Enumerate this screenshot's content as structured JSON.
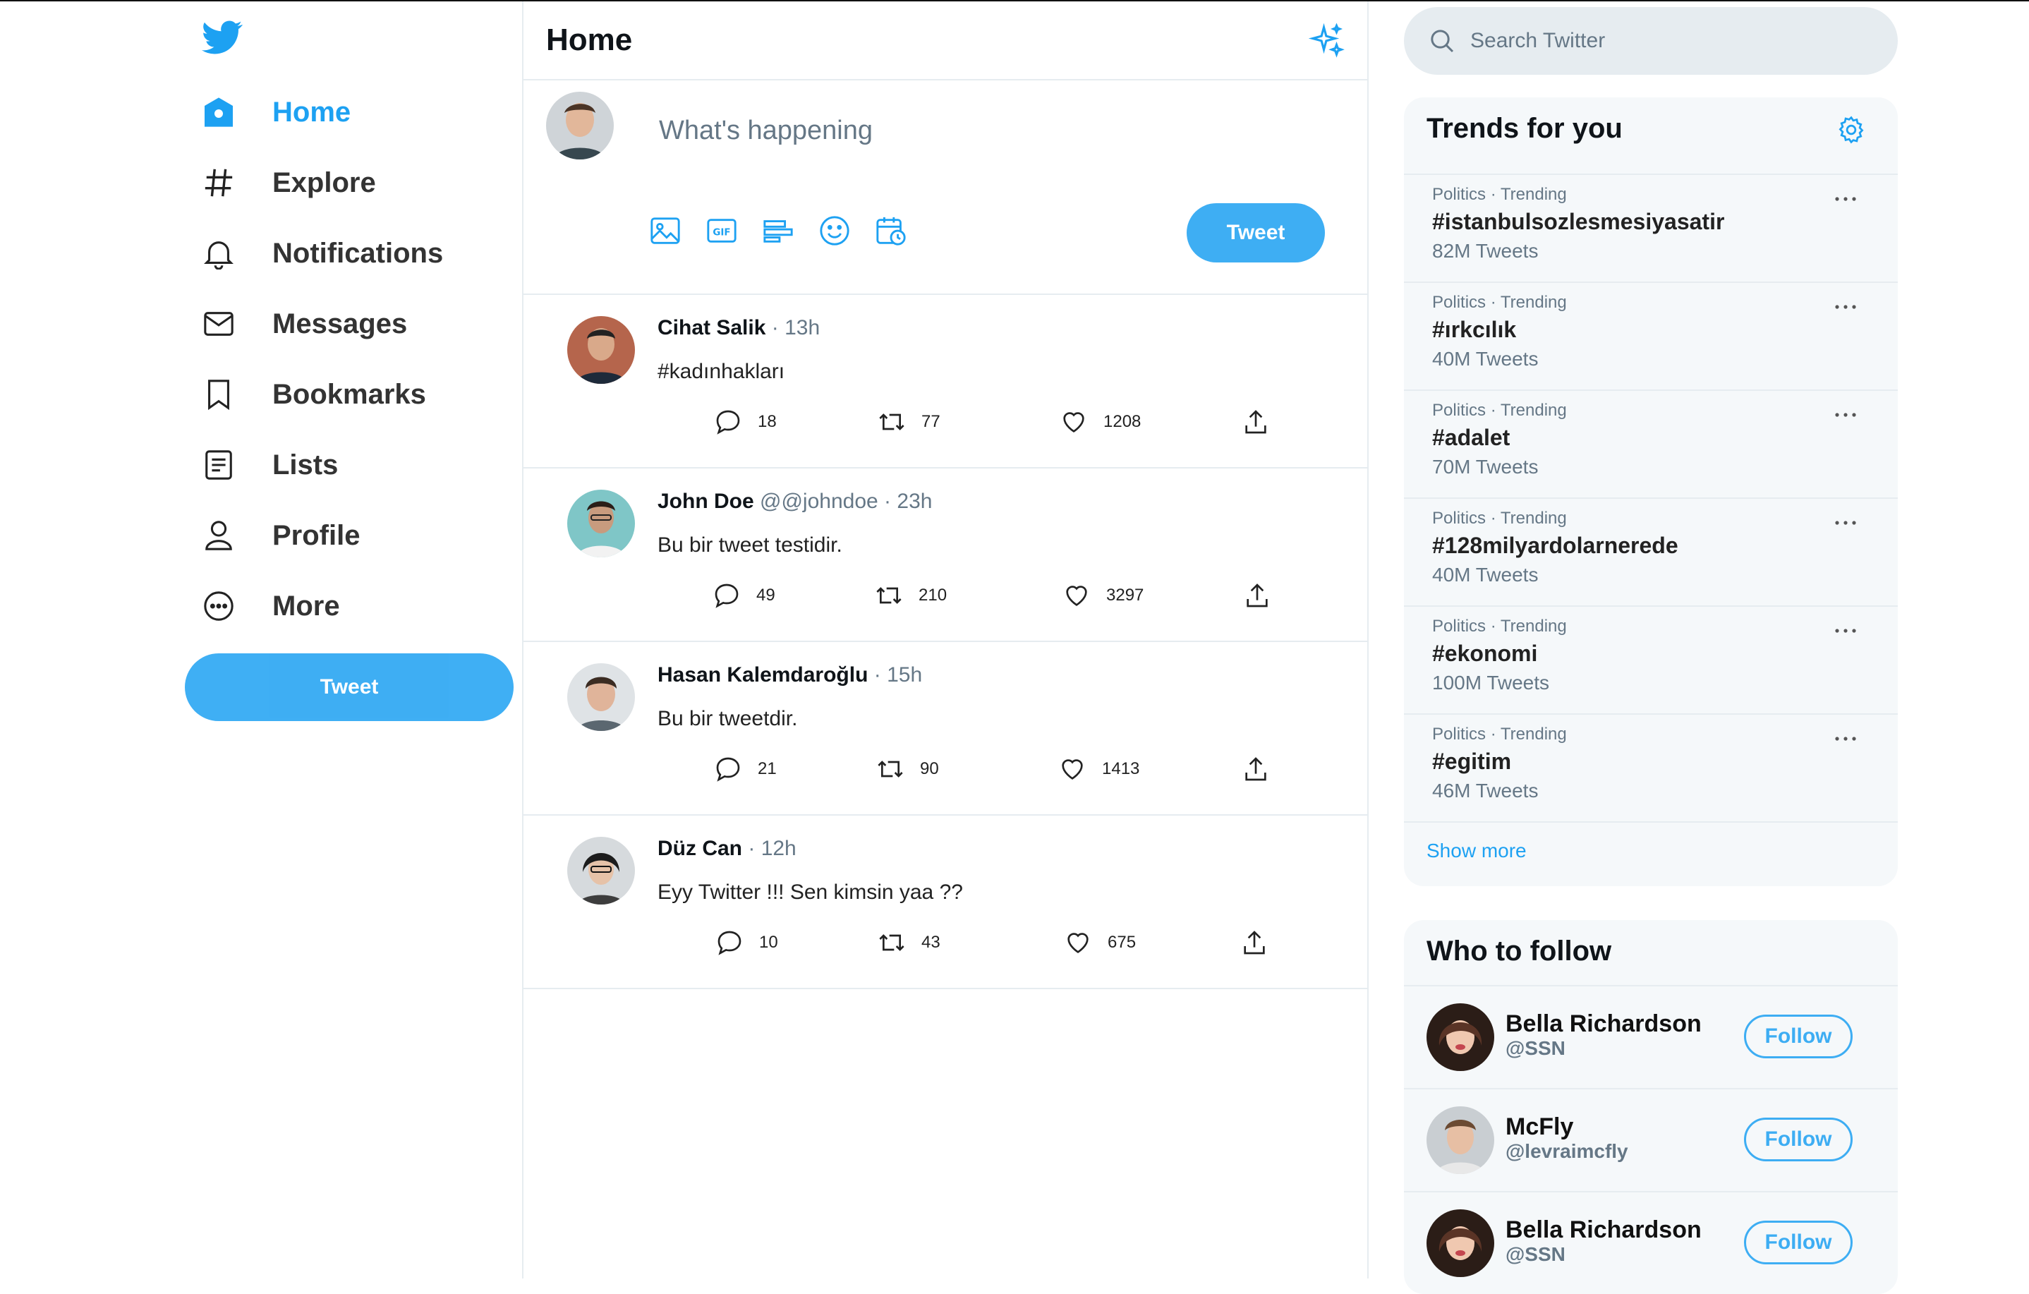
{
  "sidebar": {
    "items": [
      {
        "label": "Home",
        "icon": "home-icon",
        "active": true
      },
      {
        "label": "Explore",
        "icon": "hashtag-icon"
      },
      {
        "label": "Notifications",
        "icon": "bell-icon"
      },
      {
        "label": "Messages",
        "icon": "mail-icon"
      },
      {
        "label": "Bookmarks",
        "icon": "bookmark-icon"
      },
      {
        "label": "Lists",
        "icon": "list-icon"
      },
      {
        "label": "Profile",
        "icon": "user-icon"
      },
      {
        "label": "More",
        "icon": "more-circle-icon"
      }
    ],
    "tweet_label": "Tweet"
  },
  "main": {
    "title": "Home",
    "composer": {
      "placeholder": "What's happening",
      "tweet_label": "Tweet"
    },
    "tweets": [
      {
        "name": "Cihat Salik",
        "handle": "",
        "time": "13h",
        "text": "#kadınhakları",
        "replies": "18",
        "retweets": "77",
        "likes": "1208"
      },
      {
        "name": "John Doe",
        "handle": "@@johndoe",
        "time": "23h",
        "text": "Bu bir tweet testidir.",
        "replies": "49",
        "retweets": "210",
        "likes": "3297"
      },
      {
        "name": "Hasan Kalemdaroğlu",
        "handle": "",
        "time": "15h",
        "text": "Bu bir tweetdir.",
        "replies": "21",
        "retweets": "90",
        "likes": "1413"
      },
      {
        "name": "Düz Can",
        "handle": "",
        "time": "12h",
        "text": "Eyy Twitter !!! Sen kimsin yaa ??",
        "replies": "10",
        "retweets": "43",
        "likes": "675"
      }
    ]
  },
  "search": {
    "placeholder": "Search Twitter"
  },
  "trends": {
    "title": "Trends for you",
    "items": [
      {
        "meta": "Politics · Trending",
        "tag": "#istanbulsozlesmesiyasatir",
        "count": "82M Tweets"
      },
      {
        "meta": "Politics · Trending",
        "tag": "#ırkcılık",
        "count": "40M Tweets"
      },
      {
        "meta": "Politics · Trending",
        "tag": "#adalet",
        "count": "70M Tweets"
      },
      {
        "meta": "Politics · Trending",
        "tag": "#128milyardolarnerede",
        "count": "40M Tweets"
      },
      {
        "meta": "Politics · Trending",
        "tag": "#ekonomi",
        "count": "100M Tweets"
      },
      {
        "meta": "Politics · Trending",
        "tag": "#egitim",
        "count": "46M Tweets"
      }
    ],
    "show_more": "Show more"
  },
  "who_to_follow": {
    "title": "Who to follow",
    "users": [
      {
        "name": "Bella Richardson",
        "handle": "@SSN",
        "button": "Follow"
      },
      {
        "name": "McFly",
        "handle": "@levraimcfly",
        "button": "Follow"
      },
      {
        "name": "Bella Richardson",
        "handle": "@SSN",
        "button": "Follow"
      }
    ]
  },
  "colors": {
    "accent": "#1da1f2",
    "border": "#e6ecf0",
    "panel": "#f5f8fa",
    "muted": "#657786"
  }
}
